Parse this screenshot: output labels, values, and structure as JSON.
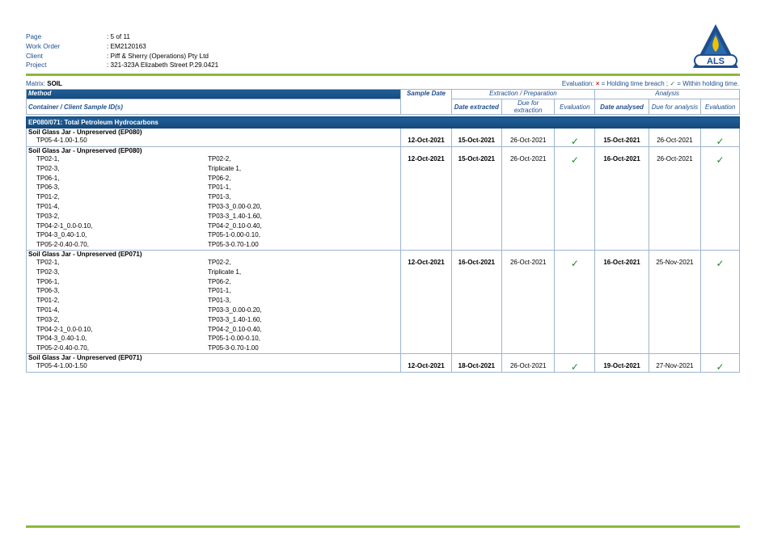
{
  "header": {
    "rows": [
      {
        "label": "Page",
        "value": ": 5 of 11"
      },
      {
        "label": "Work Order",
        "value": ": EM2120163"
      },
      {
        "label": "Client",
        "value": ": Piff & Sherry (Operations) Pty Ltd"
      },
      {
        "label": "Project",
        "value": ": 321-323A Elizabeth Street P.29.0421"
      }
    ],
    "logo_text": "ALS"
  },
  "matrix": {
    "label": "Matrix:",
    "value": "SOIL"
  },
  "evaluation_key": {
    "prefix": "Evaluation:",
    "breach_symbol": "×",
    "breach_text": "= Holding time breach ;",
    "within_symbol": "✓",
    "within_text": "= Within holding time."
  },
  "table": {
    "method_label": "Method",
    "container_label": "Container / Client Sample ID(s)",
    "sample_date": "Sample Date",
    "extraction_group": "Extraction / Preparation",
    "analysis_group": "Analysis",
    "columns": [
      "Date extracted",
      "Due for extraction",
      "Evaluation",
      "Date analysed",
      "Due for analysis",
      "Evaluation"
    ],
    "section_title": "EP080/071: Total Petroleum Hydrocarbons",
    "groups": [
      {
        "container": "Soil Glass Jar - Unpreserved (EP080)",
        "samples": [
          "TP05-4-1.00-1.50"
        ],
        "sample_date": "12-Oct-2021",
        "date_extracted": "15-Oct-2021",
        "due_extraction": "26-Oct-2021",
        "eval_extraction": "✓",
        "date_analysed": "15-Oct-2021",
        "due_analysis": "26-Oct-2021",
        "eval_analysis": "✓"
      },
      {
        "container": "Soil Glass Jar - Unpreserved (EP080)",
        "samples": [
          "TP02-1,",
          "TP02-2,",
          "TP02-3,",
          "Triplicate 1,",
          "TP06-1,",
          "TP06-2,",
          "TP06-3,",
          "TP01-1,",
          "TP01-2,",
          "TP01-3,",
          "TP01-4,",
          "TP03-3_0.00-0.20,",
          "TP03-2,",
          "TP03-3_1.40-1.60,",
          "TP04-2-1_0.0-0.10,",
          "TP04-2_0.10-0.40,",
          "TP04-3_0.40-1.0,",
          "TP05-1-0.00-0.10,",
          "TP05-2-0.40-0.70,",
          "TP05-3-0.70-1.00"
        ],
        "sample_date": "12-Oct-2021",
        "date_extracted": "15-Oct-2021",
        "due_extraction": "26-Oct-2021",
        "eval_extraction": "✓",
        "date_analysed": "16-Oct-2021",
        "due_analysis": "26-Oct-2021",
        "eval_analysis": "✓"
      },
      {
        "container": "Soil Glass Jar - Unpreserved (EP071)",
        "samples": [
          "TP02-1,",
          "TP02-2,",
          "TP02-3,",
          "Triplicate 1,",
          "TP06-1,",
          "TP06-2,",
          "TP06-3,",
          "TP01-1,",
          "TP01-2,",
          "TP01-3,",
          "TP01-4,",
          "TP03-3_0.00-0.20,",
          "TP03-2,",
          "TP03-3_1.40-1.60,",
          "TP04-2-1_0.0-0.10,",
          "TP04-2_0.10-0.40,",
          "TP04-3_0.40-1.0,",
          "TP05-1-0.00-0.10,",
          "TP05-2-0.40-0.70,",
          "TP05-3-0.70-1.00"
        ],
        "sample_date": "12-Oct-2021",
        "date_extracted": "16-Oct-2021",
        "due_extraction": "26-Oct-2021",
        "eval_extraction": "✓",
        "date_analysed": "16-Oct-2021",
        "due_analysis": "25-Nov-2021",
        "eval_analysis": "✓"
      },
      {
        "container": "Soil Glass Jar - Unpreserved (EP071)",
        "samples": [
          "TP05-4-1.00-1.50"
        ],
        "sample_date": "12-Oct-2021",
        "date_extracted": "18-Oct-2021",
        "due_extraction": "26-Oct-2021",
        "eval_extraction": "✓",
        "date_analysed": "19-Oct-2021",
        "due_analysis": "27-Nov-2021",
        "eval_analysis": "✓"
      }
    ]
  },
  "colors": {
    "accent_green": "#8db83a",
    "header_blue": "#1f5f9a",
    "label_blue": "#1f4e8c",
    "check_green": "#1c8a2a"
  }
}
